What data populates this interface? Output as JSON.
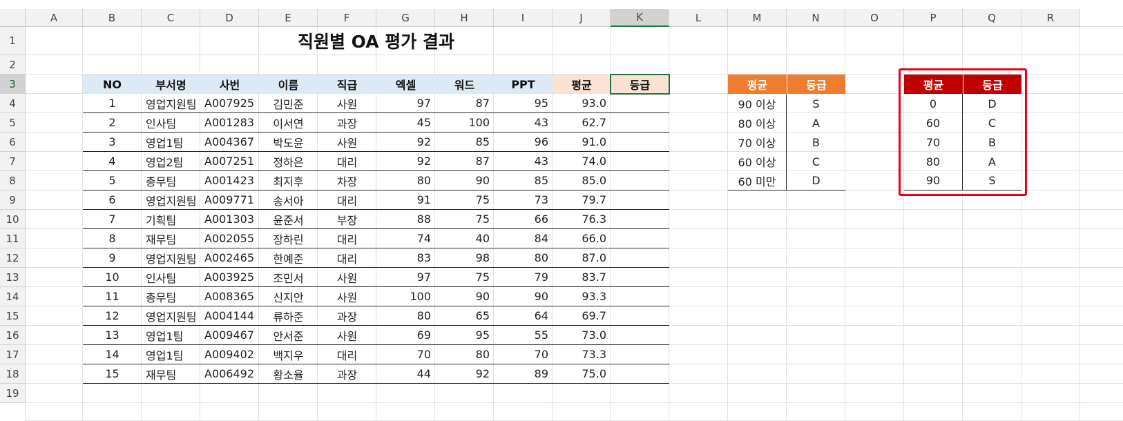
{
  "columns": [
    "A",
    "B",
    "C",
    "D",
    "E",
    "F",
    "G",
    "H",
    "I",
    "J",
    "K",
    "L",
    "M",
    "N",
    "O",
    "P",
    "Q",
    "R"
  ],
  "rows": [
    "1",
    "2",
    "3",
    "4",
    "5",
    "6",
    "7",
    "8",
    "9",
    "10",
    "11",
    "12",
    "13",
    "14",
    "15",
    "16",
    "17",
    "18",
    "19"
  ],
  "selected_column": "K",
  "selected_row": "3",
  "title": "직원별 OA 평가 결과",
  "main_table": {
    "headers": [
      "NO",
      "부서명",
      "사번",
      "이름",
      "직급",
      "엑셀",
      "워드",
      "PPT",
      "평균",
      "등급"
    ],
    "rows": [
      [
        "1",
        "영업지원팀",
        "A007925",
        "김민준",
        "사원",
        "97",
        "87",
        "95",
        "93.0",
        ""
      ],
      [
        "2",
        "인사팀",
        "A001283",
        "이서연",
        "과장",
        "45",
        "100",
        "43",
        "62.7",
        ""
      ],
      [
        "3",
        "영업1팀",
        "A004367",
        "박도윤",
        "사원",
        "92",
        "85",
        "96",
        "91.0",
        ""
      ],
      [
        "4",
        "영업2팀",
        "A007251",
        "정하은",
        "대리",
        "92",
        "87",
        "43",
        "74.0",
        ""
      ],
      [
        "5",
        "총무팀",
        "A001423",
        "최지후",
        "차장",
        "80",
        "90",
        "85",
        "85.0",
        ""
      ],
      [
        "6",
        "영업지원팀",
        "A009771",
        "송서아",
        "대리",
        "91",
        "75",
        "73",
        "79.7",
        ""
      ],
      [
        "7",
        "기획팀",
        "A001303",
        "윤준서",
        "부장",
        "88",
        "75",
        "66",
        "76.3",
        ""
      ],
      [
        "8",
        "재무팀",
        "A002055",
        "장하린",
        "대리",
        "74",
        "40",
        "84",
        "66.0",
        ""
      ],
      [
        "9",
        "영업지원팀",
        "A002465",
        "한예준",
        "대리",
        "83",
        "98",
        "80",
        "87.0",
        ""
      ],
      [
        "10",
        "인사팀",
        "A003925",
        "조민서",
        "사원",
        "97",
        "75",
        "79",
        "83.7",
        ""
      ],
      [
        "11",
        "총무팀",
        "A008365",
        "신지안",
        "사원",
        "100",
        "90",
        "90",
        "93.3",
        ""
      ],
      [
        "12",
        "영업지원팀",
        "A004144",
        "류하준",
        "과장",
        "80",
        "65",
        "64",
        "69.7",
        ""
      ],
      [
        "13",
        "영업1팀",
        "A009467",
        "안서준",
        "사원",
        "69",
        "95",
        "55",
        "73.0",
        ""
      ],
      [
        "14",
        "영업1팀",
        "A009402",
        "백지우",
        "대리",
        "70",
        "80",
        "70",
        "73.3",
        ""
      ],
      [
        "15",
        "재무팀",
        "A006492",
        "황소율",
        "과장",
        "44",
        "92",
        "89",
        "75.0",
        ""
      ]
    ]
  },
  "grade_table_1": {
    "headers": [
      "평균",
      "등급"
    ],
    "rows": [
      [
        "90 이상",
        "S"
      ],
      [
        "80 이상",
        "A"
      ],
      [
        "70 이상",
        "B"
      ],
      [
        "60 이상",
        "C"
      ],
      [
        "60 미만",
        "D"
      ]
    ]
  },
  "grade_table_2": {
    "headers": [
      "평균",
      "등급"
    ],
    "rows": [
      [
        "0",
        "D"
      ],
      [
        "60",
        "C"
      ],
      [
        "70",
        "B"
      ],
      [
        "80",
        "A"
      ],
      [
        "90",
        "S"
      ]
    ]
  },
  "colors": {
    "header_blue": "#dde9f5",
    "header_peach": "#fbe2d3",
    "orange_header": "#ee7d31",
    "red_header": "#c00000",
    "highlight_box": "#e8001c",
    "selection": "#217346"
  }
}
